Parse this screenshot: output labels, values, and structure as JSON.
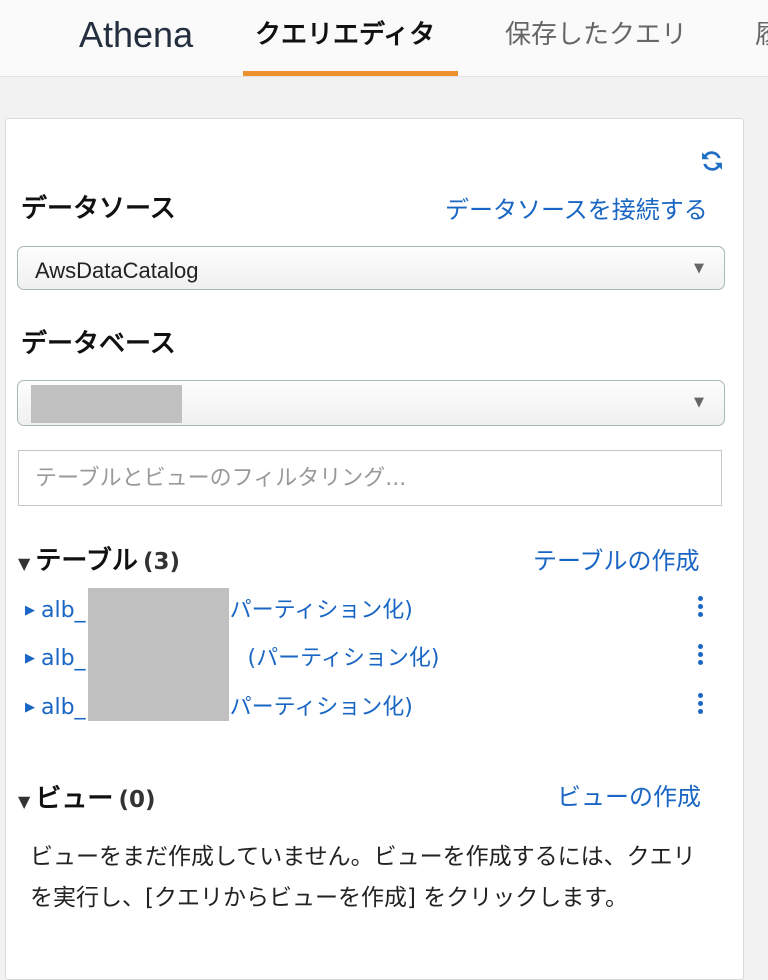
{
  "header": {
    "brand": "Athena",
    "tabs": [
      {
        "label": "クエリエディタ",
        "active": true
      },
      {
        "label": "保存したクエリ",
        "active": false
      },
      {
        "label": "履",
        "active": false
      }
    ],
    "accent_color": "#ec912d"
  },
  "panel": {
    "refresh_icon": "refresh-icon",
    "data_source": {
      "label": "データソース",
      "connect_link": "データソースを接続する",
      "selected": "AwsDataCatalog"
    },
    "database": {
      "label": "データベース",
      "selected": ""
    },
    "filter": {
      "placeholder": "テーブルとビューのフィルタリング..."
    },
    "tables": {
      "title": "テーブル",
      "count": "(3)",
      "create_link": "テーブルの作成",
      "items": [
        {
          "prefix": "alb_",
          "suffix": "パーティション化)"
        },
        {
          "prefix": "alb_",
          "suffix": " (パーティション化)"
        },
        {
          "prefix": "alb_",
          "suffix": "パーティション化)"
        }
      ]
    },
    "views": {
      "title": "ビュー",
      "count": "(0)",
      "create_link": "ビューの作成",
      "empty_message": "ビューをまだ作成していません。ビューを作成するには、クエリを実行し、[クエリからビューを作成] をクリックします。"
    }
  },
  "link_color": "#1a66c4"
}
